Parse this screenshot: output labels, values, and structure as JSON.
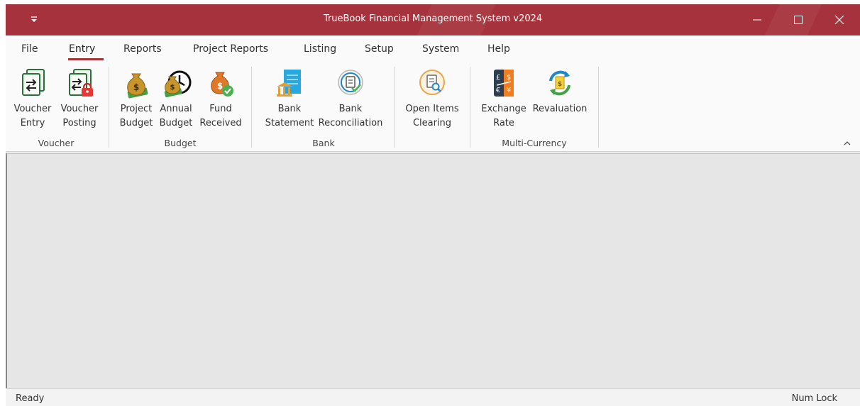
{
  "window": {
    "title": "TrueBook Financial Management System v2024",
    "accent_color": "#a5323c"
  },
  "menu": {
    "tabs": [
      {
        "label": "File"
      },
      {
        "label": "Entry",
        "active": true
      },
      {
        "label": "Reports"
      },
      {
        "label": "Project Reports"
      },
      {
        "label": "Listing"
      },
      {
        "label": "Setup"
      },
      {
        "label": "System"
      },
      {
        "label": "Help"
      }
    ]
  },
  "ribbon": {
    "groups": [
      {
        "label": "Voucher",
        "buttons": [
          {
            "line1": "Voucher",
            "line2": "Entry",
            "icon": "voucher-entry-icon"
          },
          {
            "line1": "Voucher",
            "line2": "Posting",
            "icon": "voucher-posting-icon"
          }
        ]
      },
      {
        "label": "Budget",
        "buttons": [
          {
            "line1": "Project",
            "line2": "Budget",
            "icon": "money-bag-icon"
          },
          {
            "line1": "Annual",
            "line2": "Budget",
            "icon": "money-clock-icon"
          },
          {
            "line1": "Fund",
            "line2": "Received",
            "icon": "money-bag-check-icon"
          }
        ]
      },
      {
        "label": "Bank",
        "buttons": [
          {
            "line1": "Bank",
            "line2": "Statement",
            "icon": "bank-statement-icon"
          },
          {
            "line1": "Bank",
            "line2": "Reconciliation",
            "icon": "reconciliation-icon"
          }
        ]
      },
      {
        "label": "",
        "buttons": [
          {
            "line1": "Open Items",
            "line2": "Clearing",
            "icon": "open-items-icon"
          }
        ]
      },
      {
        "label": "Multi-Currency",
        "buttons": [
          {
            "line1": "Exchange",
            "line2": "Rate",
            "icon": "currency-exchange-icon"
          },
          {
            "line1": "Revaluation",
            "line2": "",
            "icon": "revaluation-icon"
          }
        ]
      }
    ]
  },
  "status": {
    "left": "Ready",
    "right": "Num Lock"
  }
}
